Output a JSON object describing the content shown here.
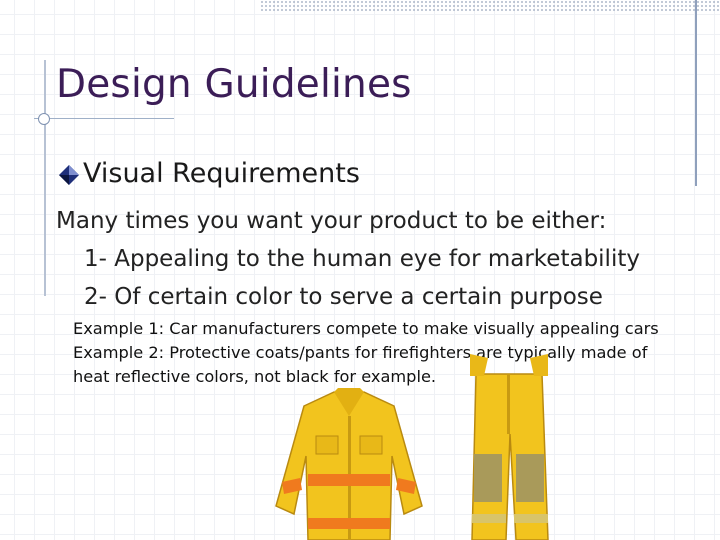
{
  "slide": {
    "title": "Design Guidelines",
    "bullet": {
      "icon": "diamond-bullet-icon",
      "text": "Visual Requirements"
    },
    "paragraph": {
      "intro": "Many times you want your product to be either:",
      "items": [
        "1- Appealing to the human eye for marketability",
        "2- Of certain color to serve a certain purpose"
      ]
    },
    "examples": [
      "Example 1:  Car manufacturers compete to make visually appealing cars",
      "Example 2:  Protective coats/pants for firefighters are typically made of",
      "heat reflective colors, not black for example."
    ],
    "images": {
      "coat": "firefighter-coat-image",
      "pants": "firefighter-pants-image"
    },
    "colors": {
      "title": "#3b1d57",
      "gear_yellow": "#f2c41e",
      "gear_stripe": "#f07a1e"
    }
  }
}
